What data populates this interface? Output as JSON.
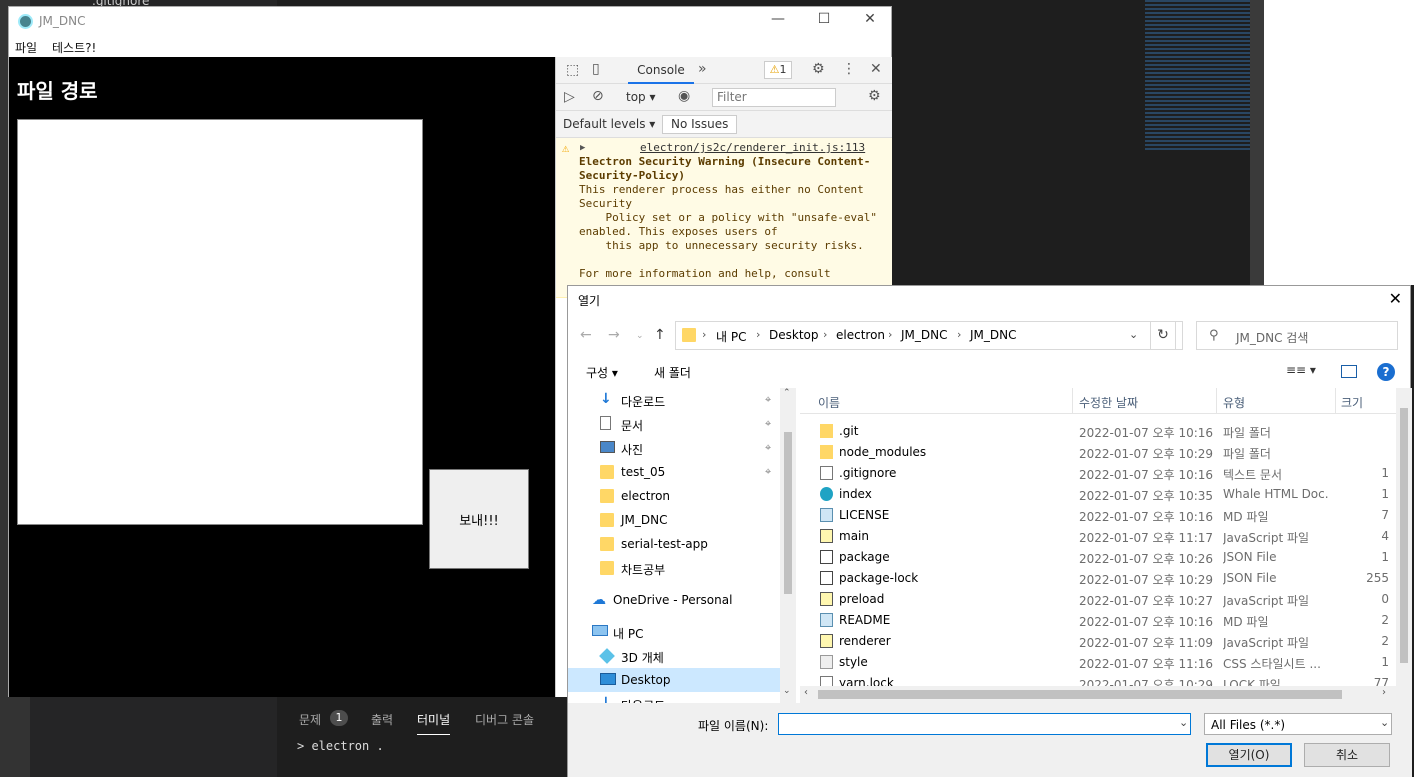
{
  "vscode": {
    "sidebar_file": ".gitignore",
    "panel_tabs": [
      "문제",
      "출력",
      "터미널",
      "디버그 콘솔"
    ],
    "problems_count": "1",
    "terminal_line": "> electron ."
  },
  "app": {
    "title": "JM_DNC",
    "menu": [
      "파일",
      "테스트?!"
    ],
    "heading": "파일 경로",
    "send_label": "보내!!!"
  },
  "devtools": {
    "console_tab": "Console",
    "more_tabs": "»",
    "warning_count": "1",
    "context": "top",
    "filter_placeholder": "Filter",
    "levels": "Default levels",
    "issues": "No Issues",
    "message": {
      "source": "electron/js2c/renderer_init.js:113",
      "title": "Electron Security Warning (Insecure Content-Security-Policy)",
      "body": "This renderer process has either no Content Security\n    Policy set or a policy with \"unsafe-eval\" enabled. This exposes users of\n    this app to unnecessary security risks.\n\nFor more information and help, consult"
    }
  },
  "dialog": {
    "title": "열기",
    "breadcrumb": [
      "내 PC",
      "Desktop",
      "electron",
      "JM_DNC",
      "JM_DNC"
    ],
    "search_placeholder": "JM_DNC 검색",
    "organize": "구성",
    "new_folder": "새 폴더",
    "help": "?",
    "nav_items": [
      {
        "label": "다운로드",
        "icon": "download-icon",
        "pinned": true
      },
      {
        "label": "문서",
        "icon": "document-icon",
        "pinned": true
      },
      {
        "label": "사진",
        "icon": "pictures-icon",
        "pinned": true
      },
      {
        "label": "test_05",
        "icon": "folder-icon",
        "pinned": true
      },
      {
        "label": "electron",
        "icon": "folder-icon",
        "pinned": false
      },
      {
        "label": "JM_DNC",
        "icon": "folder-icon",
        "pinned": false
      },
      {
        "label": "serial-test-app",
        "icon": "folder-icon",
        "pinned": false
      },
      {
        "label": "차트공부",
        "icon": "folder-icon",
        "pinned": false
      },
      {
        "label": "OneDrive - Personal",
        "icon": "cloud-icon",
        "pinned": false
      },
      {
        "label": "내 PC",
        "icon": "pc-icon",
        "pinned": false
      },
      {
        "label": "3D 개체",
        "icon": "cube-icon",
        "pinned": false
      },
      {
        "label": "Desktop",
        "icon": "desktop-icon",
        "pinned": false,
        "selected": true
      },
      {
        "label": "다운로드",
        "icon": "download-icon",
        "pinned": false
      }
    ],
    "columns": [
      "이름",
      "수정한 날짜",
      "유형",
      "크기"
    ],
    "files": [
      {
        "name": ".git",
        "date": "2022-01-07 오후 10:16",
        "type": "파일 폴더",
        "size": "",
        "icon": "folder"
      },
      {
        "name": "node_modules",
        "date": "2022-01-07 오후 10:29",
        "type": "파일 폴더",
        "size": "",
        "icon": "folder"
      },
      {
        "name": ".gitignore",
        "date": "2022-01-07 오후 10:16",
        "type": "텍스트 문서",
        "size": "1",
        "icon": "text"
      },
      {
        "name": "index",
        "date": "2022-01-07 오후 10:35",
        "type": "Whale HTML Doc...",
        "size": "1",
        "icon": "whale"
      },
      {
        "name": "LICENSE",
        "date": "2022-01-07 오후 10:16",
        "type": "MD 파일",
        "size": "7",
        "icon": "md"
      },
      {
        "name": "main",
        "date": "2022-01-07 오후 11:17",
        "type": "JavaScript 파일",
        "size": "4",
        "icon": "js"
      },
      {
        "name": "package",
        "date": "2022-01-07 오후 10:26",
        "type": "JSON File",
        "size": "1",
        "icon": "json"
      },
      {
        "name": "package-lock",
        "date": "2022-01-07 오후 10:29",
        "type": "JSON File",
        "size": "255",
        "icon": "json"
      },
      {
        "name": "preload",
        "date": "2022-01-07 오후 10:27",
        "type": "JavaScript 파일",
        "size": "0",
        "icon": "js"
      },
      {
        "name": "README",
        "date": "2022-01-07 오후 10:16",
        "type": "MD 파일",
        "size": "2",
        "icon": "md"
      },
      {
        "name": "renderer",
        "date": "2022-01-07 오후 11:09",
        "type": "JavaScript 파일",
        "size": "2",
        "icon": "js"
      },
      {
        "name": "style",
        "date": "2022-01-07 오후 11:16",
        "type": "CSS 스타일시트 ...",
        "size": "1",
        "icon": "css"
      },
      {
        "name": "yarn.lock",
        "date": "2022-01-07 오후 10:29",
        "type": "LOCK 파일",
        "size": "77",
        "icon": "text"
      }
    ],
    "filename_label": "파일 이름(N):",
    "filename_value": "",
    "filetype": "All Files (*.*)",
    "open_label": "열기(O)",
    "cancel_label": "취소"
  },
  "colors": {
    "accent": "#0078d7",
    "folder": "#ffd766",
    "selection": "#cce8ff",
    "warning_bg": "#fffbe5"
  }
}
